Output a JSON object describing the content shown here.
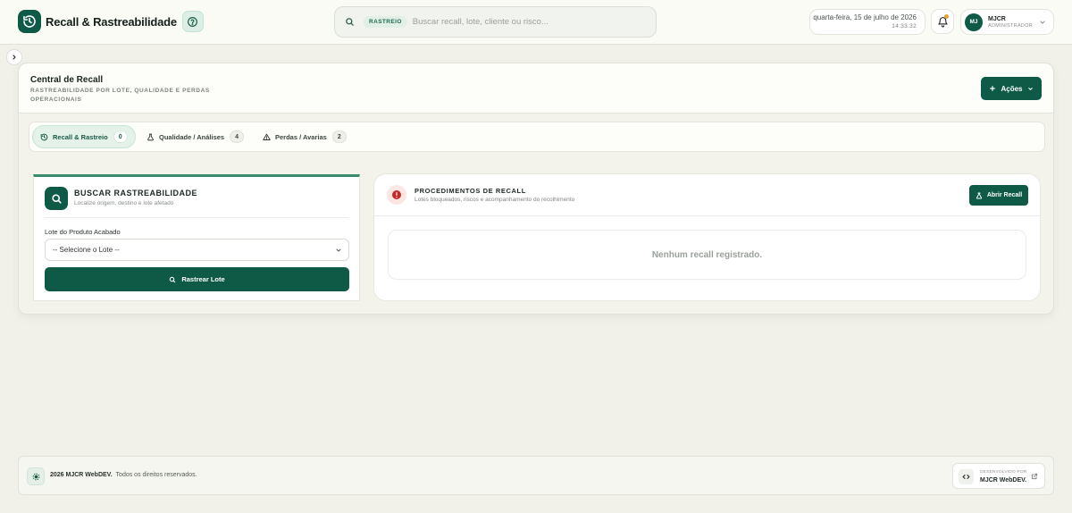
{
  "header": {
    "app_title": "Recall & Rastreabilidade",
    "search": {
      "tag": "RASTREIO",
      "placeholder": "Buscar recall, lote, cliente ou risco..."
    },
    "date": "quarta-feira, 15 de julho de 2026",
    "time": "14:33:32",
    "notification_dot": true,
    "user": {
      "initials": "MJ",
      "name": "MJCR",
      "role": "ADMINISTRADOR"
    }
  },
  "page": {
    "title": "Central de Recall",
    "subtitle": "RASTREABILIDADE POR LOTE, QUALIDADE E PERDAS OPERACIONAIS",
    "actions_label": "Ações"
  },
  "tabs": [
    {
      "label": "Recall & Rastreio",
      "count": "0",
      "icon": "history-icon",
      "active": true
    },
    {
      "label": "Qualidade / Análises",
      "count": "4",
      "icon": "flask-icon",
      "active": false
    },
    {
      "label": "Perdas / Avarias",
      "count": "2",
      "icon": "warning-icon",
      "active": false
    }
  ],
  "trace_panel": {
    "title": "BUSCAR RASTREABILIDADE",
    "subtitle": "Localize origem, destino e lote afetado",
    "field_label": "Lote do Produto Acabado",
    "select_value": "-- Selecione o Lote --",
    "button_label": "Rastrear Lote"
  },
  "recall_panel": {
    "title": "PROCEDIMENTOS DE RECALL",
    "subtitle": "Lotes bloqueados, riscos e acompanhamento do recolhimento",
    "button_label": "Abrir Recall",
    "empty_message": "Nenhum recall registrado."
  },
  "footer": {
    "brand": "2026 MJCR WebDEV.",
    "rights": "Todos os direitos reservados.",
    "dev_label": "DESENVOLVIDO POR",
    "dev_name": "MJCR WebDEV."
  },
  "colors": {
    "primary": "#0f5a46",
    "accent_line": "#3b8a6e",
    "alert": "#c62828",
    "notification": "#e0a52f",
    "background": "#f1f1ea"
  }
}
